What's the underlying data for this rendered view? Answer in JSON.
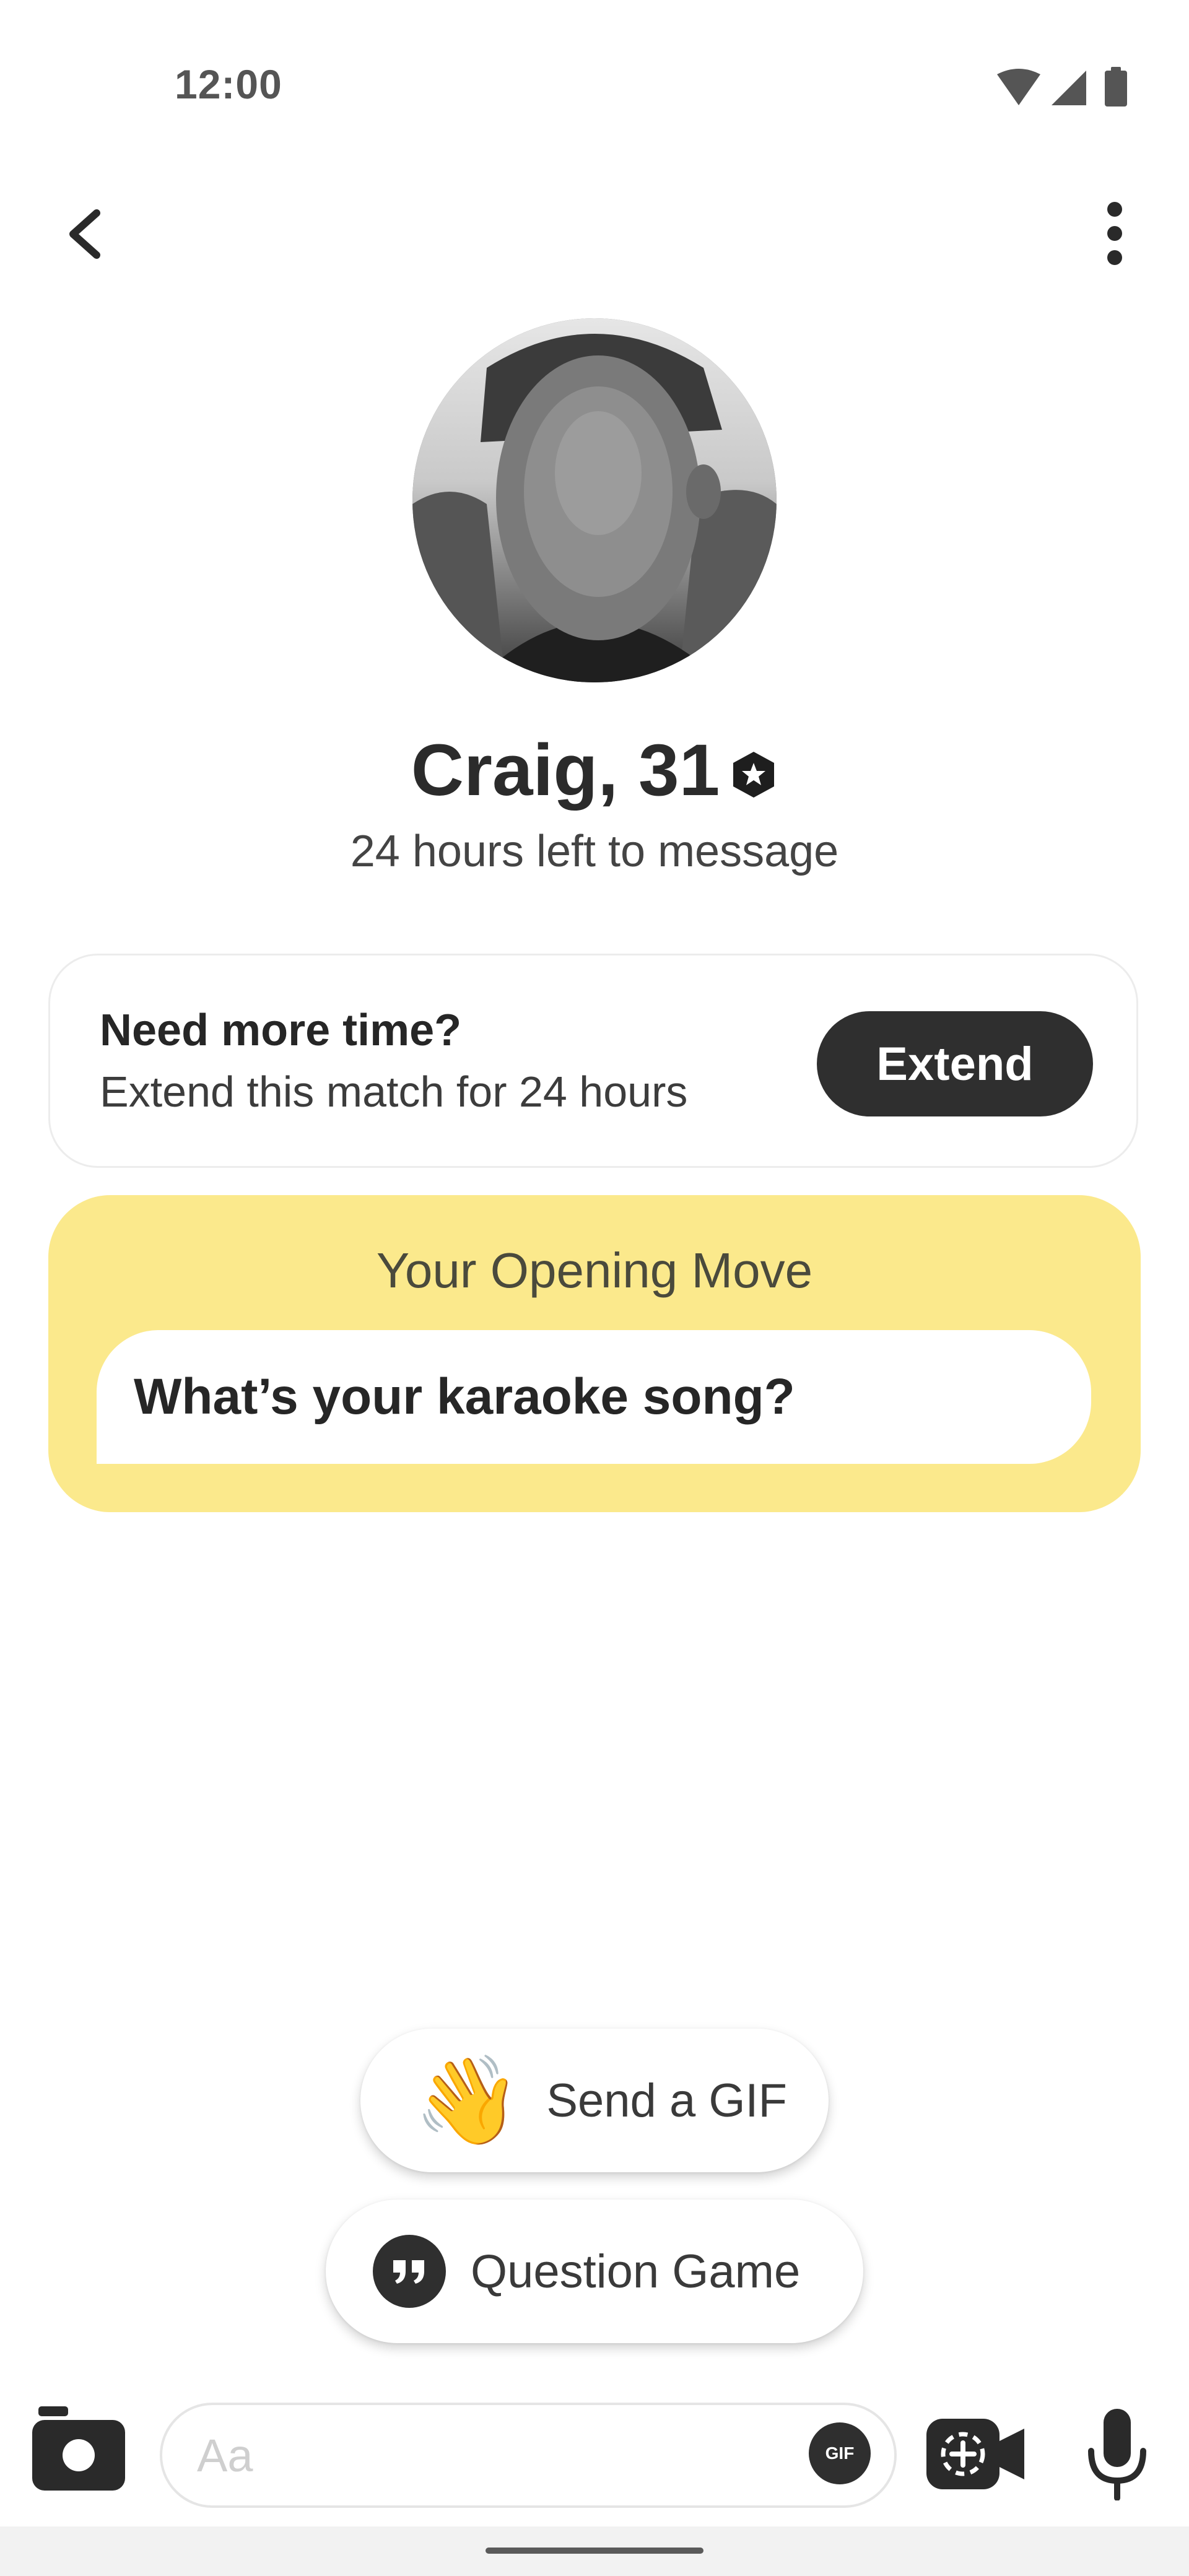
{
  "status_bar": {
    "time": "12:00",
    "icons": [
      "wifi-icon",
      "cellular-signal-icon",
      "battery-icon"
    ]
  },
  "top_bar": {
    "back_icon": "chevron-left-icon",
    "more_icon": "more-vertical-icon"
  },
  "profile": {
    "name": "Craig, 31",
    "verified_icon": "verified-badge-icon",
    "subtitle": "24 hours left to message"
  },
  "extend_card": {
    "title": "Need more time?",
    "subtitle": "Extend this match for 24 hours",
    "button_label": "Extend"
  },
  "opening_move": {
    "title": "Your Opening Move",
    "question": "What’s your karaoke song?"
  },
  "suggestions": [
    {
      "icon": "waving-hand-emoji",
      "emoji": "👋",
      "label": "Send a GIF"
    },
    {
      "icon": "quote-icon",
      "label": "Question Game"
    }
  ],
  "composer": {
    "placeholder": "Aa",
    "gif_label": "GIF",
    "camera_icon": "camera-icon",
    "video_icon": "video-call-icon",
    "mic_icon": "microphone-icon"
  },
  "colors": {
    "accent_yellow": "#fbe98c",
    "dark_button": "#2f2f2f",
    "background": "#ffffff"
  }
}
